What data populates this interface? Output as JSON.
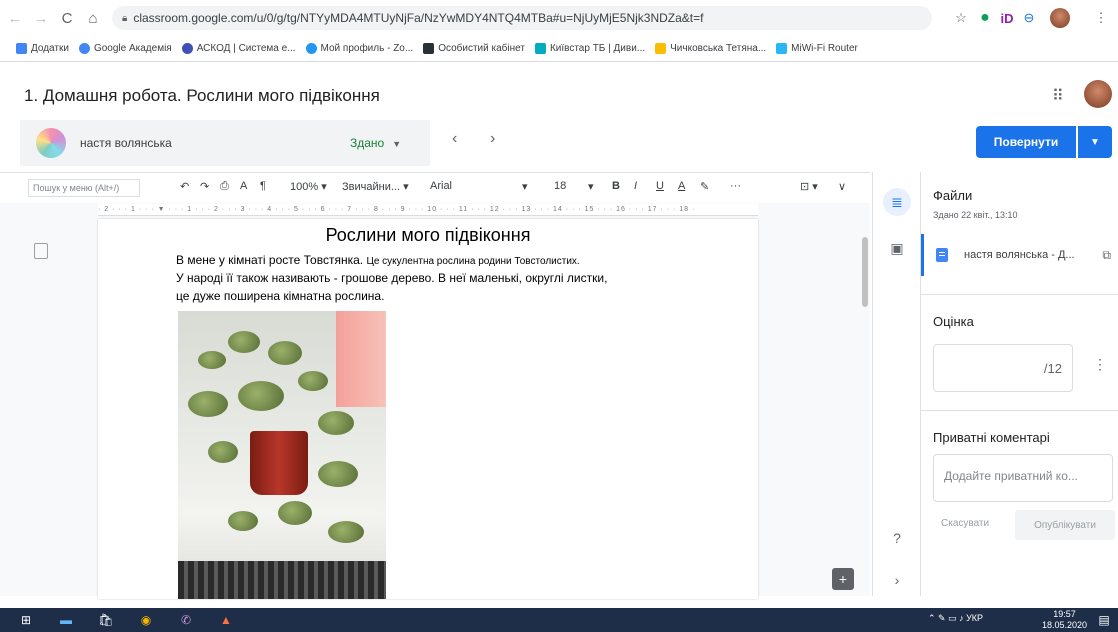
{
  "browser": {
    "url": "classroom.google.com/u/0/g/tg/NTYyMDA4MTUyNjFa/NzYwMDY4NTQ4MTBa#u=NjUyMjE5Njk3NDZa&t=f",
    "bookmarks": [
      {
        "label": "Додатки",
        "color": "#4285f4"
      },
      {
        "label": "Google Академія",
        "color": "#4285f4"
      },
      {
        "label": "АСКОД | Система е...",
        "color": "#3f51b5"
      },
      {
        "label": "Мой профиль - Zo...",
        "color": "#2196f3"
      },
      {
        "label": "Особистий кабінет",
        "color": "#263238"
      },
      {
        "label": "Київстар ТБ | Диви...",
        "color": "#00acc1"
      },
      {
        "label": "Чичковська Тетяна...",
        "color": "#fbbc04"
      },
      {
        "label": "MiWi-Fi Router",
        "color": "#29b6f6"
      }
    ]
  },
  "header": {
    "title": "1. Домашня робота. Рослини мого підвіконня"
  },
  "student": {
    "name": "настя волянська",
    "status": "Здано",
    "return_label": "Повернути"
  },
  "toolbar": {
    "menu_search_placeholder": "Пошук у меню (Alt+/)",
    "zoom": "100%",
    "style": "Звичайни...",
    "font": "Arial",
    "size": "18",
    "bold": "B",
    "italic": "I",
    "underline": "U",
    "text_color": "A",
    "more": "···"
  },
  "ruler": "· 2 · · · 1 · · · ▼ · · · 1 · · · 2 · · · 3 · · · 4 · · · 5 · · · 6 · · · 7 · · · 8 · · · 9 · · · 10 · · · 11 · · · 12 · · · 13 · · · 14 · · · 15 · · · 16 · · · 17 · · · 18 ·",
  "document": {
    "heading": "Рослини мого підвіконня",
    "line1_a": "В мене у кімнаті росте Товстянка. ",
    "line1_b": "Це сукулентна рослина родини Товстолистих.",
    "line2": " У народі її також називають - грошове дерево. В неї маленькі, округлі листки,",
    "line3": "це дуже поширена кімнатна рослина."
  },
  "panel": {
    "files_title": "Файли",
    "submitted": "Здано 22 квіт., 13:10",
    "file_name": "настя волянська - Д...",
    "grade_title": "Оцінка",
    "grade_denominator": "/12",
    "comments_title": "Приватні коментарі",
    "comment_placeholder": "Додайте приватний ко...",
    "cancel_label": "Скасувати",
    "publish_label": "Опублікувати"
  },
  "taskbar": {
    "lang": "УКР",
    "time": "19:57",
    "date": "18.05.2020"
  }
}
